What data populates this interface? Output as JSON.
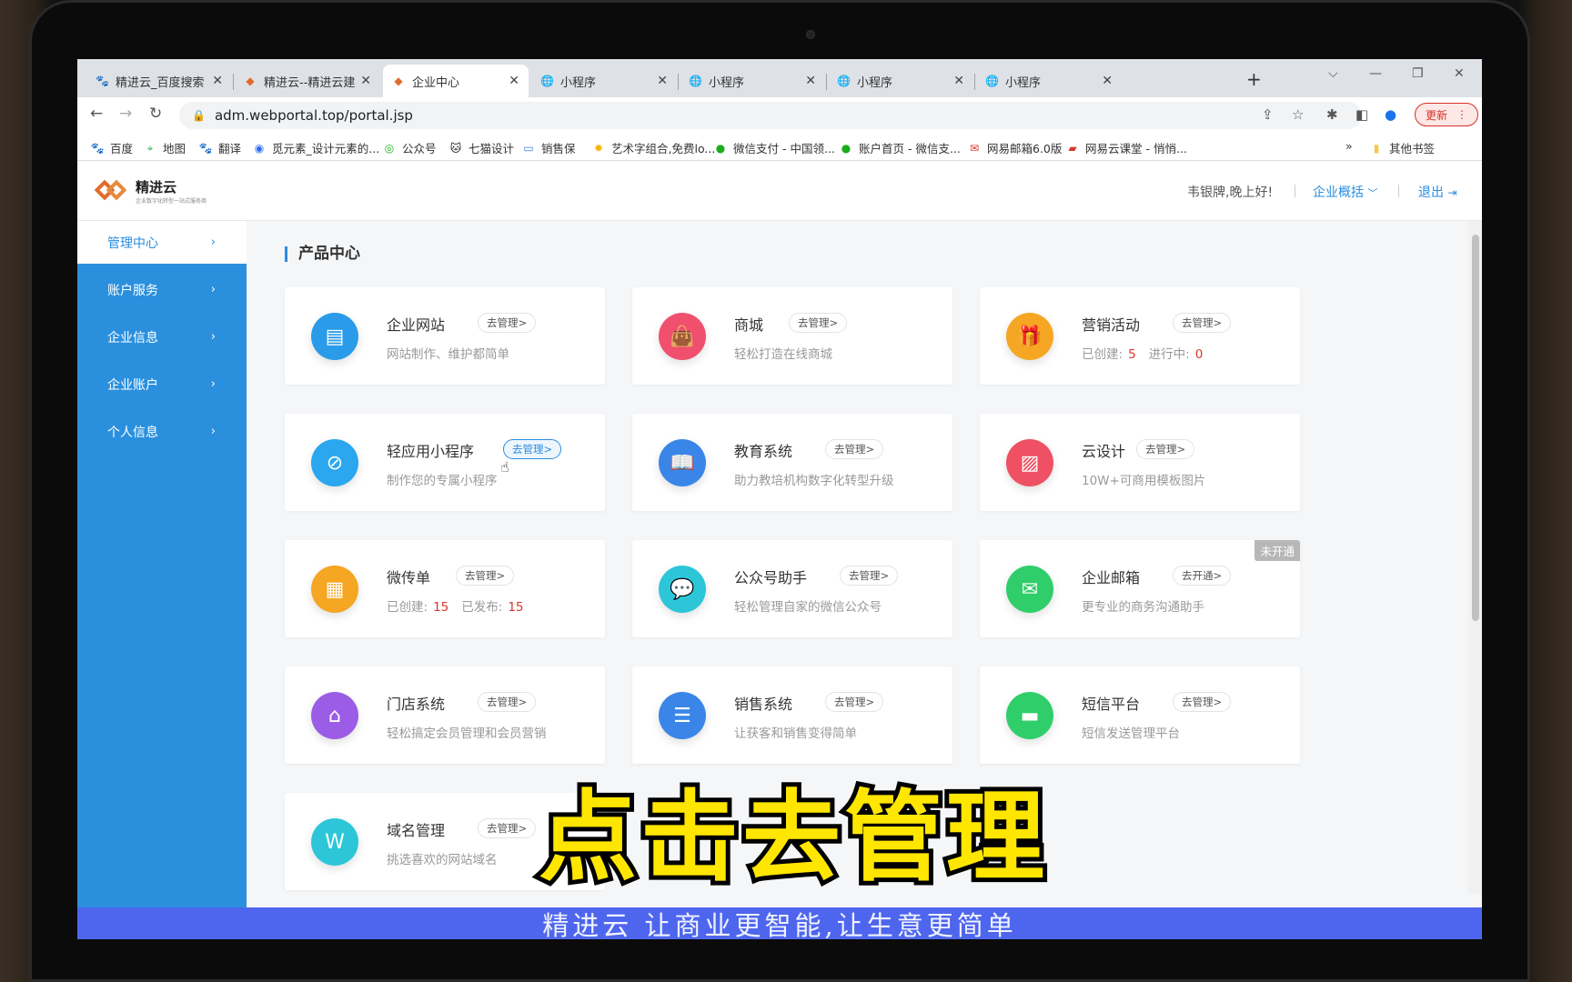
{
  "browser": {
    "tabs": [
      {
        "title": "精进云_百度搜索",
        "icon": "baidu-paw-icon"
      },
      {
        "title": "精进云--精进云建站",
        "icon": "jingjin-logo-icon"
      },
      {
        "title": "企业中心",
        "icon": "jingjin-logo-icon"
      },
      {
        "title": "小程序",
        "icon": "globe-icon"
      },
      {
        "title": "小程序",
        "icon": "globe-icon"
      },
      {
        "title": "小程序",
        "icon": "globe-icon"
      },
      {
        "title": "小程序",
        "icon": "globe-icon"
      }
    ],
    "active_tab_index": 2,
    "url": "adm.webportal.top/portal.jsp",
    "update_label": "更新",
    "bookmarks": [
      {
        "label": "百度",
        "icon": "baidu-paw-icon",
        "color": "#2932e1"
      },
      {
        "label": "地图",
        "icon": "map-icon",
        "color": "#34a853"
      },
      {
        "label": "翻译",
        "icon": "baidu-paw-icon",
        "color": "#2932e1"
      },
      {
        "label": "觅元素_设计元素的...",
        "icon": "mi-yuansu-icon",
        "color": "#2a6df4"
      },
      {
        "label": "公众号",
        "icon": "wechat-mp-icon",
        "color": "#1aad19"
      },
      {
        "label": "七猫设计",
        "icon": "cat-icon",
        "color": "#222222"
      },
      {
        "label": "销售保",
        "icon": "chat-bubble-icon",
        "color": "#3b7ddd"
      },
      {
        "label": "艺术字组合,免费lo...",
        "icon": "sun-icon",
        "color": "#f6b400"
      },
      {
        "label": "微信支付 - 中国领...",
        "icon": "wechat-pay-icon",
        "color": "#1aad19"
      },
      {
        "label": "账户首页 - 微信支...",
        "icon": "wechat-pay-icon",
        "color": "#1aad19"
      },
      {
        "label": "网易邮箱6.0版",
        "icon": "netease-mail-icon",
        "color": "#d9362b"
      },
      {
        "label": "网易云课堂 - 悄悄...",
        "icon": "netease-class-icon",
        "color": "#d9362b"
      }
    ],
    "bookmarks_more": "»",
    "other_bookmarks": "其他书签"
  },
  "site": {
    "logo_name": "精进云",
    "logo_slogan": "企业数字化转型一站式服务商",
    "greeting": "韦银牌,晚上好!",
    "overview_label": "企业概括",
    "logout_label": "退出"
  },
  "sidebar": {
    "items": [
      {
        "label": "管理中心",
        "active": true
      },
      {
        "label": "账户服务",
        "active": false
      },
      {
        "label": "企业信息",
        "active": false
      },
      {
        "label": "企业账户",
        "active": false
      },
      {
        "label": "个人信息",
        "active": false
      }
    ]
  },
  "main": {
    "section_title": "产品中心",
    "cards": [
      {
        "name": "企业网站",
        "action": "去管理>",
        "desc": "网站制作、维护都简单",
        "icon": "website-icon",
        "color": "#2a9be8"
      },
      {
        "name": "商城",
        "action": "去管理>",
        "desc": "轻松打造在线商城",
        "icon": "shopping-bag-icon",
        "color": "#f0506e"
      },
      {
        "name": "营销活动",
        "action": "去管理>",
        "desc_parts": [
          {
            "label": "已创建:",
            "value": "5"
          },
          {
            "label": "进行中:",
            "value": "0"
          }
        ],
        "icon": "gift-icon",
        "color": "#f5a623"
      },
      {
        "name": "轻应用小程序",
        "action": "去管理>",
        "desc": "制作您的专属小程序",
        "icon": "mini-program-icon",
        "color": "#2aa7ee",
        "hover": true
      },
      {
        "name": "教育系统",
        "action": "去管理>",
        "desc": "助力教培机构数字化转型升级",
        "icon": "book-icon",
        "color": "#3a86e8"
      },
      {
        "name": "云设计",
        "action": "去管理>",
        "desc": "10W+可商用模板图片",
        "icon": "image-icon",
        "color": "#ef5064"
      },
      {
        "name": "微传单",
        "action": "去管理>",
        "desc_parts": [
          {
            "label": "已创建:",
            "value": "15"
          },
          {
            "label": "已发布:",
            "value": "15"
          }
        ],
        "icon": "flyer-icon",
        "color": "#f5a623"
      },
      {
        "name": "公众号助手",
        "action": "去管理>",
        "desc": "轻松管理自家的微信公众号",
        "icon": "wechat-assistant-icon",
        "color": "#2cc6d8"
      },
      {
        "name": "企业邮箱",
        "action": "去开通>",
        "desc": "更专业的商务沟通助手",
        "icon": "mail-icon",
        "color": "#2fce6a",
        "badge": "未开通"
      },
      {
        "name": "门店系统",
        "action": "去管理>",
        "desc": "轻松搞定会员管理和会员营销",
        "icon": "store-icon",
        "color": "#9b5de5"
      },
      {
        "name": "销售系统",
        "action": "去管理>",
        "desc": "让获客和销售变得简单",
        "icon": "list-icon",
        "color": "#3a86e8"
      },
      {
        "name": "短信平台",
        "action": "去管理>",
        "desc": "短信发送管理平台",
        "icon": "sms-icon",
        "color": "#2fce6a"
      },
      {
        "name": "域名管理",
        "action": "去管理>",
        "desc": "挑选喜欢的网站域名",
        "icon": "domain-icon",
        "color": "#2cc6d8"
      }
    ]
  },
  "overlay": {
    "headline": "点击去管理",
    "caption": "精进云  让商业更智能,让生意更简单"
  }
}
